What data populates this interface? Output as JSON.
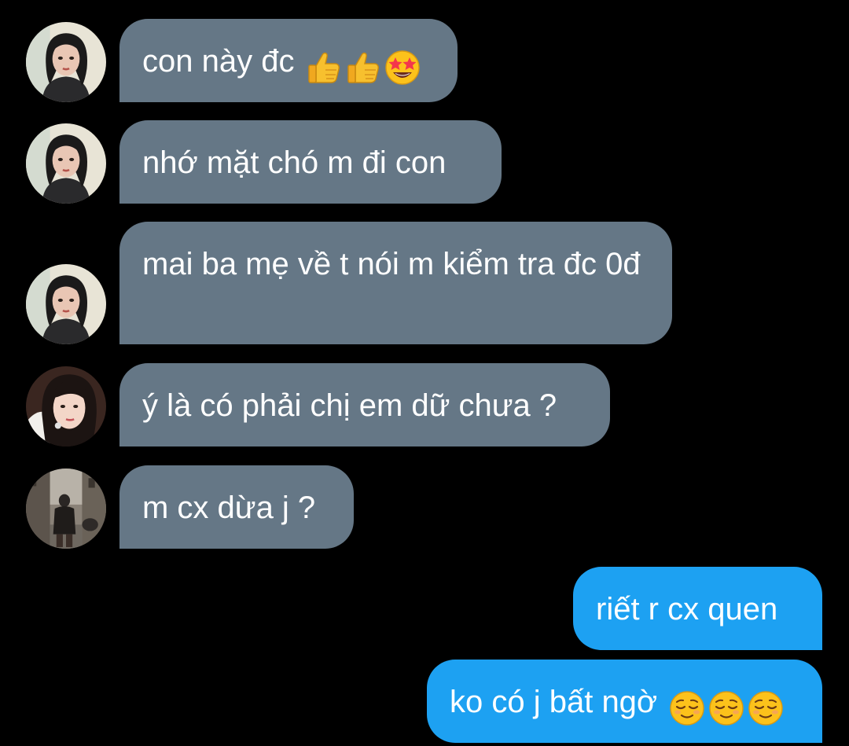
{
  "messages": [
    {
      "direction": "incoming",
      "avatar": "avatar-girl-1",
      "text": "con này đc",
      "emoji": [
        "thumbs-up-emoji",
        "thumbs-up-emoji",
        "star-struck-emoji"
      ]
    },
    {
      "direction": "incoming",
      "avatar": "avatar-girl-1",
      "text": "nhớ mặt chó m đi con"
    },
    {
      "direction": "incoming",
      "avatar": "avatar-girl-1",
      "text": "mai ba mẹ về t nói m kiểm tra đc 0đ"
    },
    {
      "direction": "incoming",
      "avatar": "avatar-girl-2",
      "text": "ý là có phải chị em dữ chưa ?"
    },
    {
      "direction": "incoming",
      "avatar": "avatar-street",
      "text": "m cx dừa j ?"
    },
    {
      "direction": "outgoing",
      "text": "riết r cx quen"
    },
    {
      "direction": "outgoing",
      "text": "ko có j bất ngờ",
      "emoji": [
        "relieved-face-emoji",
        "relieved-face-emoji",
        "relieved-face-emoji"
      ]
    }
  ],
  "colors": {
    "background": "#000000",
    "incoming_bubble": "#657786",
    "outgoing_bubble": "#1da1f2",
    "text": "#ffffff"
  }
}
